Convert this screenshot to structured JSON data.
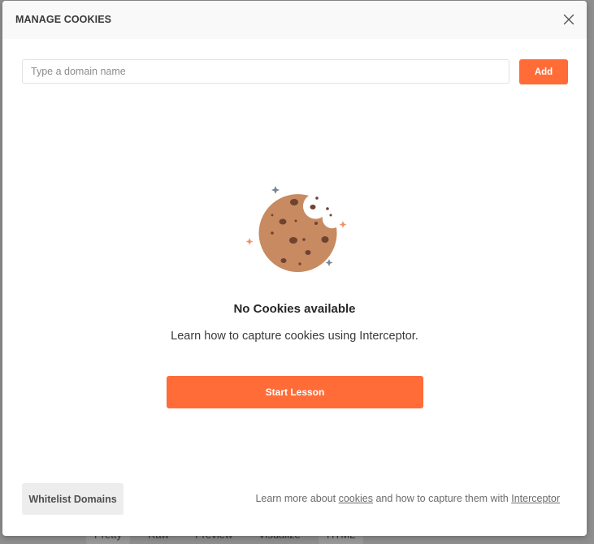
{
  "modal": {
    "title": "MANAGE COOKIES",
    "close_icon": "close-icon"
  },
  "domain_input": {
    "placeholder": "Type a domain name",
    "value": ""
  },
  "add_button": {
    "label": "Add"
  },
  "empty_state": {
    "illustration": "cookie-icon",
    "title": "No Cookies available",
    "description": "Learn how to capture cookies using Interceptor.",
    "button_label": "Start Lesson"
  },
  "footer": {
    "whitelist_label": "Whitelist Domains",
    "text_before": "Learn more about ",
    "cookies_link": "cookies",
    "text_middle": " and how to capture them with ",
    "interceptor_link": "Interceptor"
  },
  "background": {
    "tabs": [
      "Pretty",
      "Raw",
      "Preview",
      "Visualize",
      "HTML"
    ]
  },
  "colors": {
    "accent": "#ff6c37",
    "cookie_body": "#c88a61",
    "cookie_chip": "#6e4330"
  }
}
